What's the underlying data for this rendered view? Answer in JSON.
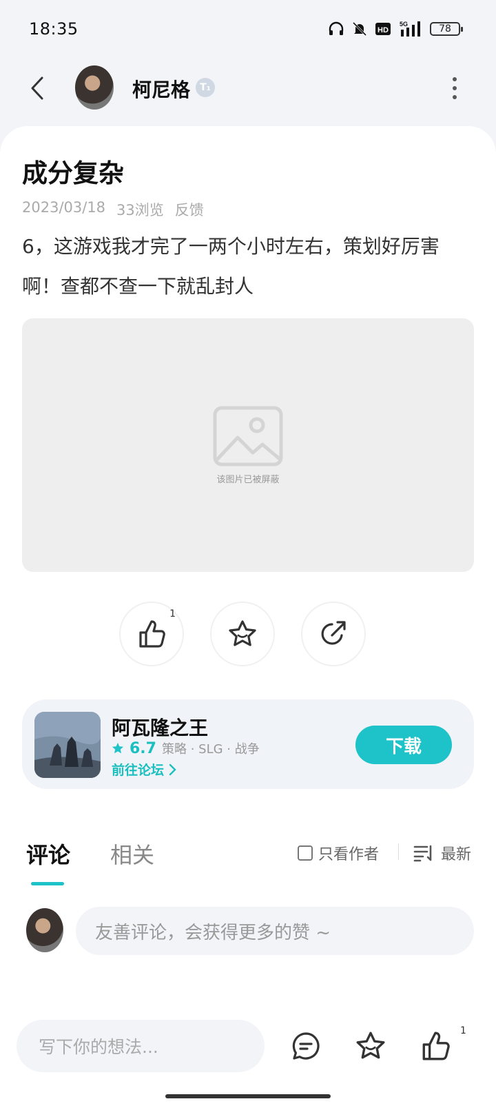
{
  "status_bar": {
    "time": "18:35",
    "battery": "78",
    "icons": [
      "headphones-icon",
      "mute-bell-icon",
      "hd-icon",
      "5g-signal-icon",
      "battery-icon"
    ]
  },
  "topbar": {
    "author_name": "柯尼格",
    "author_badge": "T₁"
  },
  "post": {
    "title": "成分复杂",
    "date": "2023/03/18",
    "views": "33浏览",
    "feedback": "反馈",
    "body": "6，这游戏我才完了一两个小时左右，策划好厉害啊！查都不查一下就乱封人",
    "blocked_image_caption": "该图片已被屏蔽"
  },
  "actions": {
    "like_count": "1"
  },
  "game": {
    "name": "阿瓦隆之王",
    "score": "6.7",
    "tags": "策略 · SLG · 战争",
    "forum_link": "前往论坛",
    "download_label": "下载",
    "accent_color": "#1ec3c9"
  },
  "comments": {
    "tab_comments": "评论",
    "tab_related": "相关",
    "only_author": "只看作者",
    "sort_label": "最新",
    "input_placeholder": "友善评论，会获得更多的赞 ~"
  },
  "bottom_bar": {
    "input_placeholder": "写下你的想法...",
    "like_count": "1"
  }
}
